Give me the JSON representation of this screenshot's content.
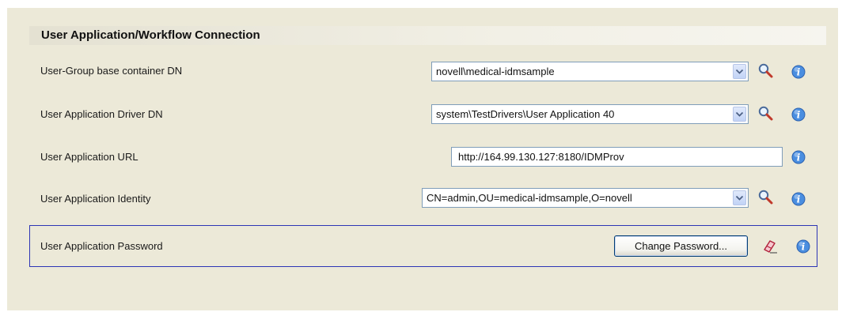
{
  "section": {
    "title": "User Application/Workflow Connection"
  },
  "rows": [
    {
      "label": "User-Group base container DN",
      "value": "novell\\medical-idmsample",
      "control": "combo"
    },
    {
      "label": "User Application Driver DN",
      "value": "system\\TestDrivers\\User Application 40",
      "control": "combo"
    },
    {
      "label": "User Application URL",
      "value": "http://164.99.130.127:8180/IDMProv",
      "control": "text"
    },
    {
      "label": "User Application Identity",
      "value": "CN=admin,OU=medical-idmsample,O=novell",
      "control": "combo"
    },
    {
      "label": "User Application Password",
      "button_label": "Change Password...",
      "control": "button"
    }
  ],
  "icons": {
    "browse": "magnifier-icon",
    "info": "info-icon",
    "clear": "eraser-icon",
    "dropdown": "chevron-down-icon"
  },
  "colors": {
    "panel_bg": "#ece9d8",
    "focus_border": "#2d35b5",
    "info_blue": "#3a7fd6",
    "eraser_red": "#c8283c"
  }
}
